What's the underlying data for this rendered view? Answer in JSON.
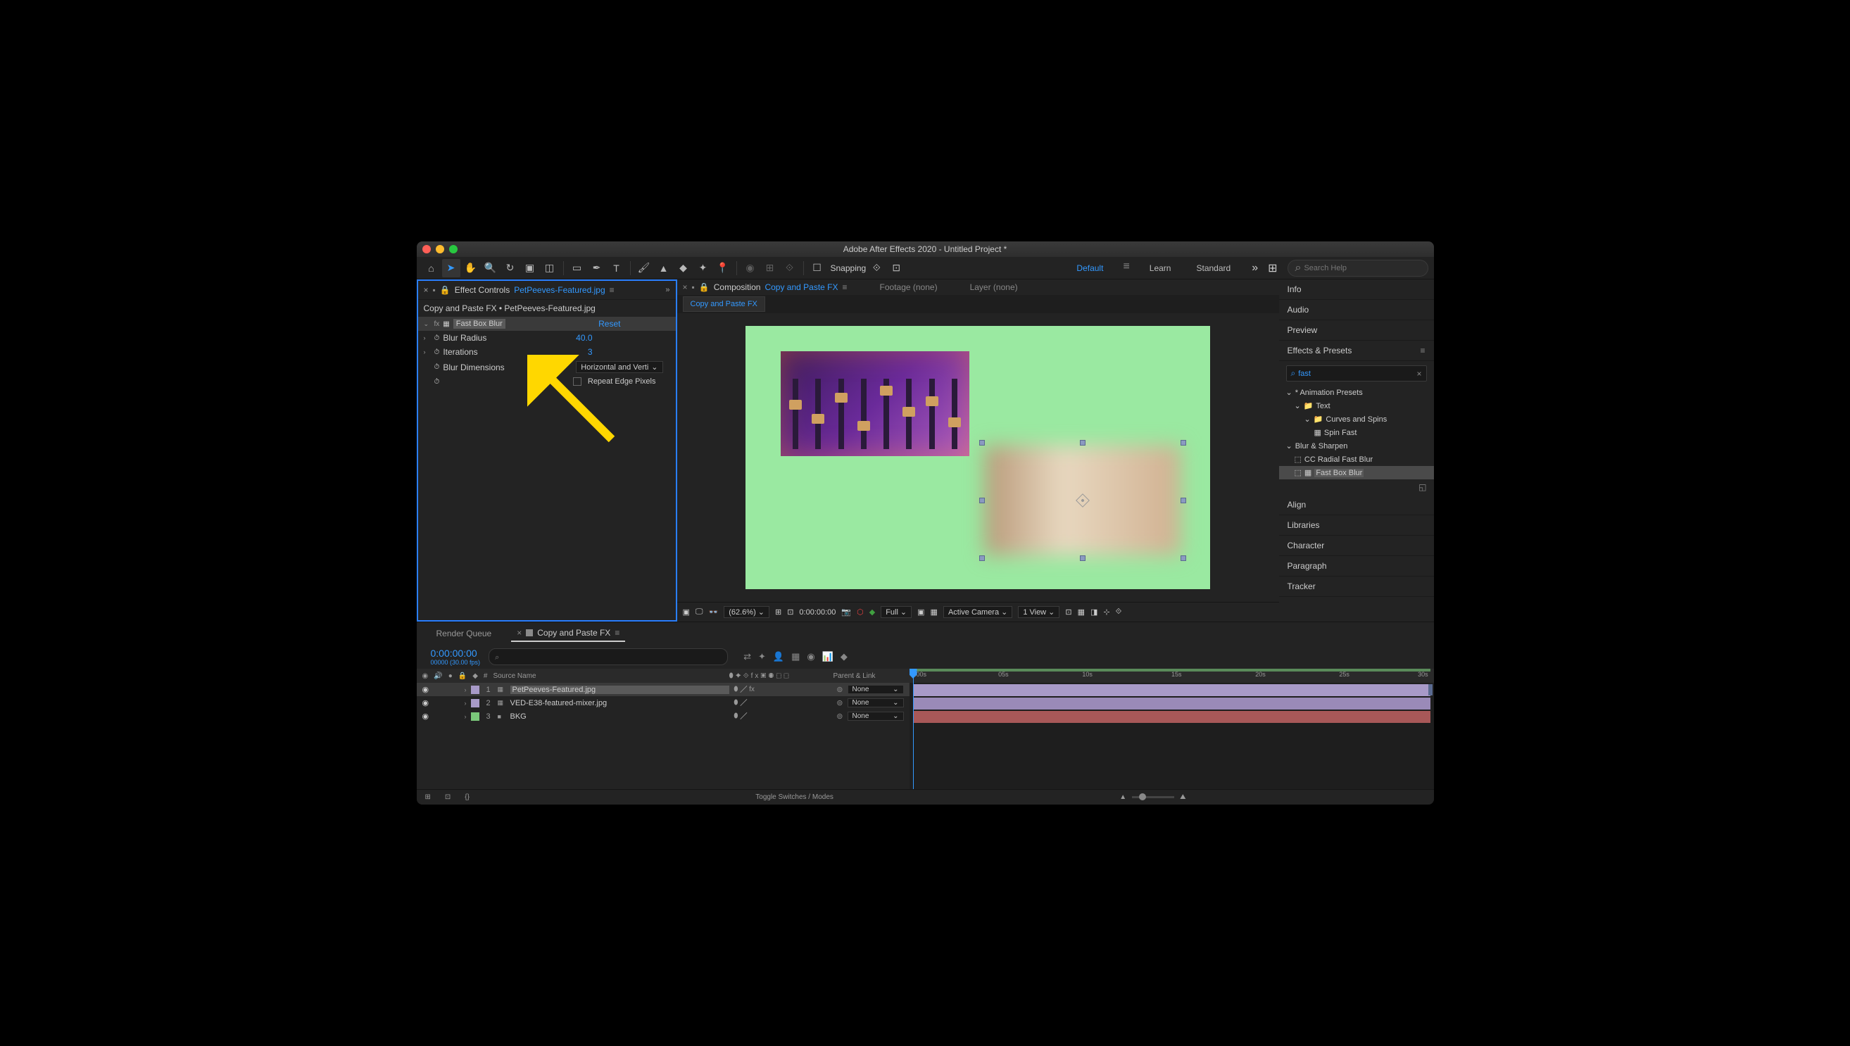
{
  "window": {
    "title": "Adobe After Effects 2020 - Untitled Project *"
  },
  "toolbar": {
    "snapping": "Snapping"
  },
  "workspaces": {
    "default": "Default",
    "learn": "Learn",
    "standard": "Standard"
  },
  "search_help": {
    "placeholder": "Search Help"
  },
  "effect_controls": {
    "panel_title": "Effect Controls",
    "file_link": "PetPeeves-Featured.jpg",
    "path": "Copy and Paste FX • PetPeeves-Featured.jpg",
    "effect_name": "Fast Box Blur",
    "reset": "Reset",
    "params": {
      "blur_radius_label": "Blur Radius",
      "blur_radius_val": "40.0",
      "iterations_label": "Iterations",
      "iterations_val": "3",
      "dimensions_label": "Blur Dimensions",
      "dimensions_val": "Horizontal and Verti",
      "repeat_label": "Repeat Edge Pixels"
    }
  },
  "composition": {
    "panel_label": "Composition",
    "name": "Copy and Paste FX",
    "footage_tab": "Footage (none)",
    "layer_tab": "Layer (none)",
    "sub_tab": "Copy and Paste FX"
  },
  "viewport_footer": {
    "zoom": "(62.6%)",
    "time": "0:00:00:00",
    "res": "Full",
    "camera": "Active Camera",
    "view": "1 View"
  },
  "right_panel": {
    "info": "Info",
    "audio": "Audio",
    "preview": "Preview",
    "effects_presets": "Effects & Presets",
    "search_val": "fast",
    "tree": {
      "anim_presets": "* Animation Presets",
      "text": "Text",
      "curves": "Curves and Spins",
      "spin_fast": "Spin Fast",
      "blur_sharpen": "Blur & Sharpen",
      "cc_radial": "CC Radial Fast Blur",
      "fast_box": "Fast Box Blur"
    },
    "align": "Align",
    "libraries": "Libraries",
    "character": "Character",
    "paragraph": "Paragraph",
    "tracker": "Tracker"
  },
  "timeline": {
    "render_queue": "Render Queue",
    "comp_name": "Copy and Paste FX",
    "timecode": "0:00:00:00",
    "frame_info": "00000 (30.00 fps)",
    "col_num": "#",
    "col_source": "Source Name",
    "col_parent": "Parent & Link",
    "layers": [
      {
        "num": "1",
        "name": "PetPeeves-Featured.jpg",
        "parent": "None"
      },
      {
        "num": "2",
        "name": "VED-E38-featured-mixer.jpg",
        "parent": "None"
      },
      {
        "num": "3",
        "name": "BKG",
        "parent": "None"
      }
    ],
    "ruler": {
      "t0": ":00s",
      "t05": "05s",
      "t10": "10s",
      "t15": "15s",
      "t20": "20s",
      "t25": "25s",
      "t30": "30s"
    },
    "toggle": "Toggle Switches / Modes"
  }
}
